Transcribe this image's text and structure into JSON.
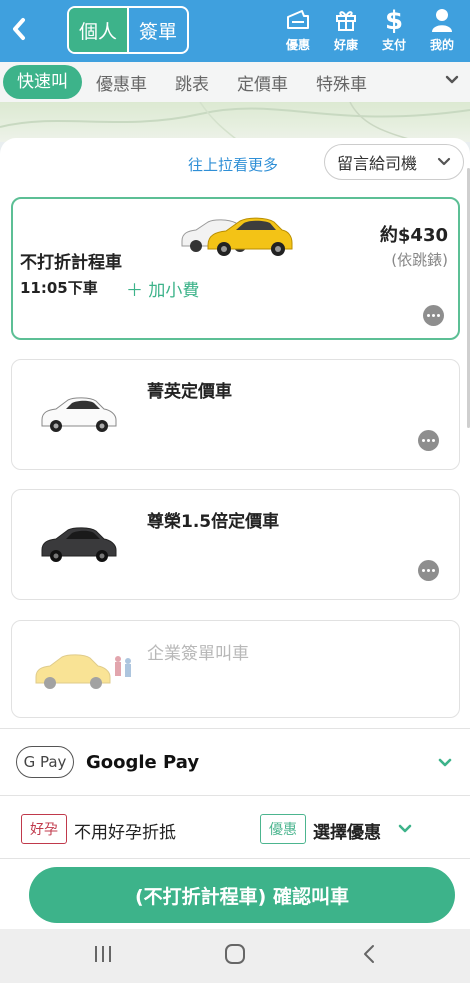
{
  "header": {
    "back_glyph": "‹",
    "segments": [
      {
        "label": "個人",
        "active": true
      },
      {
        "label": "簽單",
        "active": false
      }
    ],
    "icons": [
      {
        "icon": "ticket-icon",
        "label": "優惠"
      },
      {
        "icon": "gift-icon",
        "label": "好康"
      },
      {
        "icon": "dollar-icon",
        "label": "支付"
      },
      {
        "icon": "person-icon",
        "label": "我的"
      }
    ],
    "bg_color": "#3fa0de"
  },
  "tabs": [
    {
      "label": "快速叫",
      "active": true
    },
    {
      "label": "優惠車",
      "active": false
    },
    {
      "label": "跳表",
      "active": false
    },
    {
      "label": "定價車",
      "active": false
    },
    {
      "label": "特殊車",
      "active": false
    }
  ],
  "sheet": {
    "pull_up_hint": "往上拉看更多",
    "message_button": "留言給司機"
  },
  "cards": [
    {
      "name": "不打折計程車",
      "price": "約$430",
      "price_note": "(依跳錶)",
      "time": "11:05下車",
      "tip": "＋ 加小費",
      "selected": true,
      "car_color": "yellow"
    },
    {
      "name": "菁英定價車",
      "selected": false,
      "car_color": "white"
    },
    {
      "name": "尊榮1.5倍定價車",
      "selected": false,
      "car_color": "dark"
    },
    {
      "name": "企業簽單叫車",
      "selected": false,
      "disabled": true,
      "car_color": "yellow-faded"
    }
  ],
  "payment": {
    "badge": "G Pay",
    "method": "Google Pay"
  },
  "discounts": {
    "pregnancy_badge": "好孕",
    "pregnancy_label": "不用好孕折抵",
    "promo_badge": "優惠",
    "promo_label": "選擇優惠"
  },
  "confirm_button": "(不打折計程車) 確認叫車",
  "colors": {
    "accent_green": "#3db38a",
    "header_blue": "#3fa0de",
    "link_blue": "#2f8fd6",
    "pregnancy_red": "#c0394b"
  }
}
